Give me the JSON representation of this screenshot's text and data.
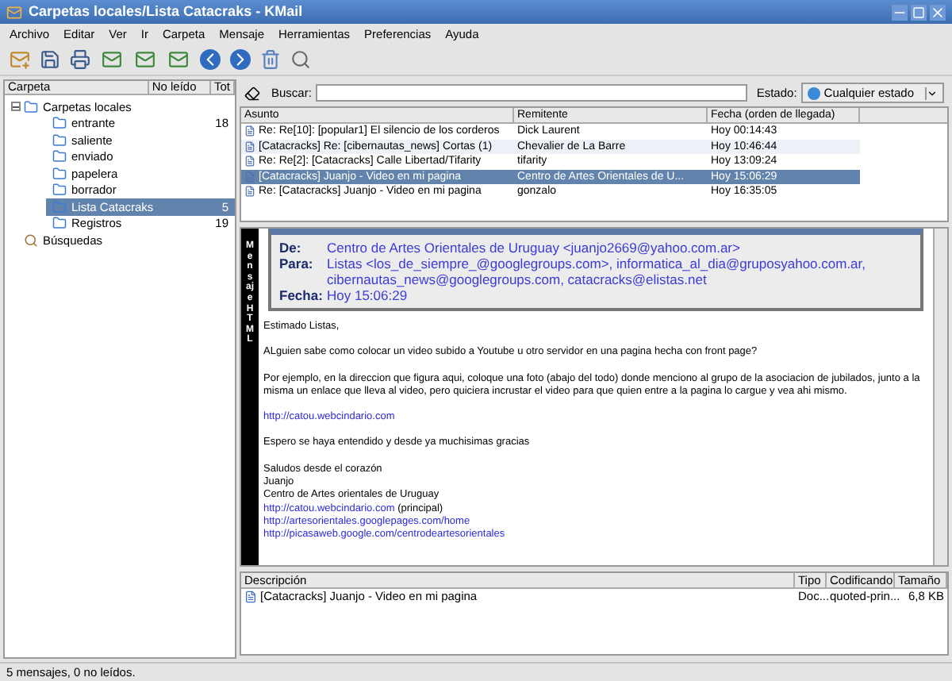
{
  "window": {
    "title": "Carpetas locales/Lista Catacraks - KMail"
  },
  "menu": [
    "Archivo",
    "Editar",
    "Ver",
    "Ir",
    "Carpeta",
    "Mensaje",
    "Herramientas",
    "Preferencias",
    "Ayuda"
  ],
  "folder_pane": {
    "columns": [
      "Carpeta",
      "No leído",
      "Tot"
    ],
    "tree": [
      {
        "name": "Carpetas locales",
        "expanded": true,
        "children": [
          {
            "name": "entrante",
            "count": "18",
            "selected": false
          },
          {
            "name": "saliente",
            "selected": false
          },
          {
            "name": "enviado",
            "selected": false
          },
          {
            "name": "papelera",
            "selected": false
          },
          {
            "name": "borrador",
            "selected": false
          },
          {
            "name": "Lista Catacraks",
            "count": "5",
            "selected": true
          },
          {
            "name": "Registros",
            "count": "19",
            "selected": false
          }
        ]
      },
      {
        "name": "Búsquedas",
        "kind": "search"
      }
    ]
  },
  "search": {
    "label": "Buscar:",
    "status_label": "Estado:",
    "status_button": "Cualquier estado"
  },
  "message_list": {
    "columns": [
      "Asunto",
      "Remitente",
      "Fecha (orden de llegada)"
    ],
    "rows": [
      {
        "subject": "Re: Re[10]: [popular1] El silencio de los corderos",
        "sender": "Dick Laurent",
        "date": "Hoy 00:14:43",
        "selected": false
      },
      {
        "subject": "[Catacracks] Re: [cibernautas_news] Cortas (1)",
        "sender": "Chevalier de La Barre",
        "date": "Hoy 10:46:44",
        "selected": false
      },
      {
        "subject": "Re: Re[2]: [Catacracks] Calle Libertad/Tifarity",
        "sender": "tifarity",
        "date": "Hoy 13:09:24",
        "selected": false
      },
      {
        "subject": "[Catacracks] Juanjo - Video en mi pagina",
        "sender": "Centro de Artes Orientales de U...",
        "date": "Hoy 15:06:29",
        "selected": true
      },
      {
        "subject": "Re: [Catacracks] Juanjo - Video en mi pagina",
        "sender": "gonzalo",
        "date": "Hoy 16:35:05",
        "selected": false
      }
    ]
  },
  "message": {
    "vertical_label": "Mensaje HTML",
    "header": [
      {
        "label": "De:",
        "value": "Centro de Artes Orientales de Uruguay <juanjo2669@yahoo.com.ar>"
      },
      {
        "label": "Para:",
        "value": "Listas <los_de_siempre_@googlegroups.com>, informatica_al_dia@gruposyahoo.com.ar, cibernautas_news@googlegroups.com, catacracks@elistas.net"
      },
      {
        "label": "Fecha:",
        "value": "Hoy 15:06:29"
      }
    ],
    "paragraphs": [
      [
        {
          "kind": "text",
          "text": "Estimado Listas,"
        }
      ],
      [
        {
          "kind": "text",
          "text": "ALguien sabe como colocar un video subido a Youtube u otro servidor en una pagina hecha con front page?"
        }
      ],
      [
        {
          "kind": "text",
          "text": "Por ejemplo, en la direccion que figura aqui, coloque una foto (abajo del todo) donde menciono al grupo de la asociacion de jubilados, junto a la misma un enlace que lleva al video, pero quiciera incrustar el video para que quien entre a la pagina lo cargue y vea ahi mismo."
        }
      ],
      [
        {
          "kind": "link",
          "text": "http://catou.webcindario.com"
        }
      ],
      [
        {
          "kind": "text",
          "text": "Espero se haya entendido y desde ya muchisimas gracias"
        }
      ],
      [
        {
          "kind": "text",
          "text": "Saludos desde el corazón"
        },
        {
          "kind": "text",
          "text": "Juanjo"
        },
        {
          "kind": "text",
          "text": "Centro de Artes orientales de Uruguay"
        },
        {
          "kind": "link",
          "text": "http://catou.webcindario.com",
          "note": "(principal)"
        },
        {
          "kind": "link",
          "text": "http://artesorientales.googlepages.com/home"
        },
        {
          "kind": "link",
          "text": "http://picasaweb.google.com/centrodeartesorientales"
        }
      ]
    ]
  },
  "attachments": {
    "columns": [
      "Descripción",
      "Tipo",
      "Codificando",
      "Tamaño"
    ],
    "rows": [
      {
        "description": "[Catacracks] Juanjo - Video en mi pagina",
        "type": "Doc...",
        "encoding": "quoted-prin...",
        "size": "6,8 KB"
      }
    ]
  },
  "status_bar": "5 mensajes, 0 no leídos."
}
